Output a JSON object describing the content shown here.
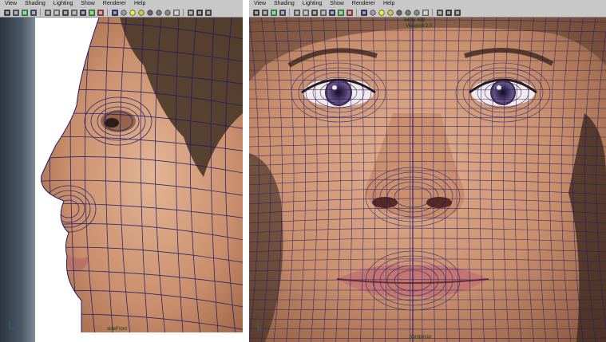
{
  "colors": {
    "wire": "#1d1a6a",
    "menubar": "#c8c8c8",
    "skin_light": "#d9a987",
    "skin_dark": "#8e5a3e",
    "hair": "#4a3728",
    "lips": "#c57a73",
    "backdrop_left": "#3b4754",
    "label": "#0b3a0b"
  },
  "menu": [
    "View",
    "Shading",
    "Lighting",
    "Show",
    "Renderer",
    "Help"
  ],
  "toolbar_icons": [
    "select-camera-icon",
    "camera-attributes-icon",
    "bookmark-icon",
    "image-plane-icon",
    "grid-icon",
    "film-gate-icon",
    "resolution-gate-icon",
    "gate-mask-icon",
    "field-chart-icon",
    "safe-action-icon",
    "safe-title-icon",
    "wireframe-icon",
    "smooth-shade-icon",
    "default-lighting-icon",
    "all-lights-icon",
    "textured-icon",
    "shadows-icon",
    "xray-icon",
    "xray-joints-icon",
    "isolate-select-icon",
    "wireframe-on-shaded-icon",
    "film-back-icon"
  ],
  "left_viewport": {
    "camera_label": "sideFront",
    "axis": "axis-indicator"
  },
  "right_viewport": {
    "camera_label": "frontpersp",
    "resolution_label": "640 x 480",
    "viewport_label": "Viewport 2.0",
    "axis": "axis-indicator"
  }
}
